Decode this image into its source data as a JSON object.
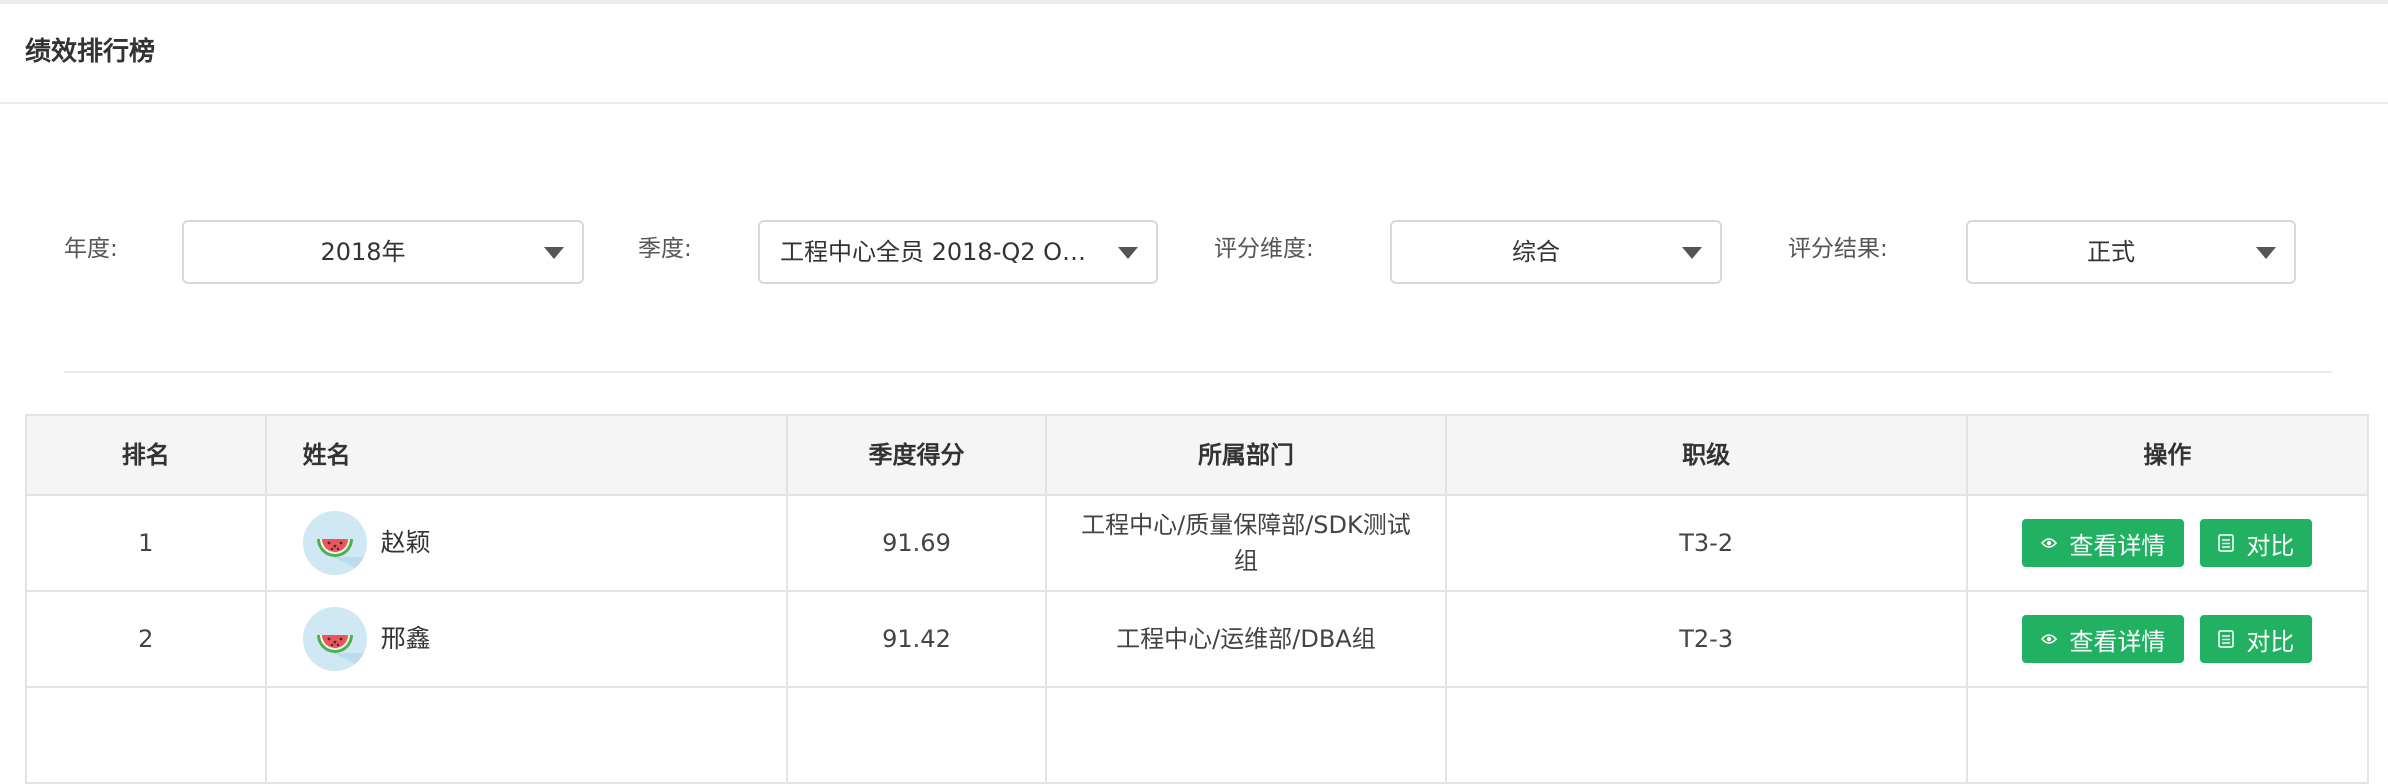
{
  "page": {
    "title": "绩效排行榜"
  },
  "filters": {
    "year": {
      "label": "年度:",
      "value": "2018年"
    },
    "quarter": {
      "label": "季度:",
      "value": "工程中心全员 2018-Q2 OKR..."
    },
    "dimension": {
      "label": "评分维度:",
      "value": "综合"
    },
    "result": {
      "label": "评分结果:",
      "value": "正式"
    }
  },
  "table": {
    "columns": [
      "排名",
      "姓名",
      "季度得分",
      "所属部门",
      "职级",
      "操作"
    ],
    "rows": [
      {
        "rank": "1",
        "name": "赵颖",
        "score": "91.69",
        "department": "工程中心/质量保障部/SDK测试组",
        "level": "T3-2"
      },
      {
        "rank": "2",
        "name": "邢鑫",
        "score": "91.42",
        "department": "工程中心/运维部/DBA组",
        "level": "T2-3"
      }
    ],
    "actions": {
      "detail": "查看详情",
      "compare": "对比"
    }
  },
  "colors": {
    "accent": "#22b163",
    "header_bg": "#f5f5f5",
    "border": "#e3e3e3"
  },
  "icons": {
    "avatar": "watermelon-icon",
    "detail": "eye-icon",
    "compare": "document-icon",
    "select": "caret-down-icon"
  }
}
